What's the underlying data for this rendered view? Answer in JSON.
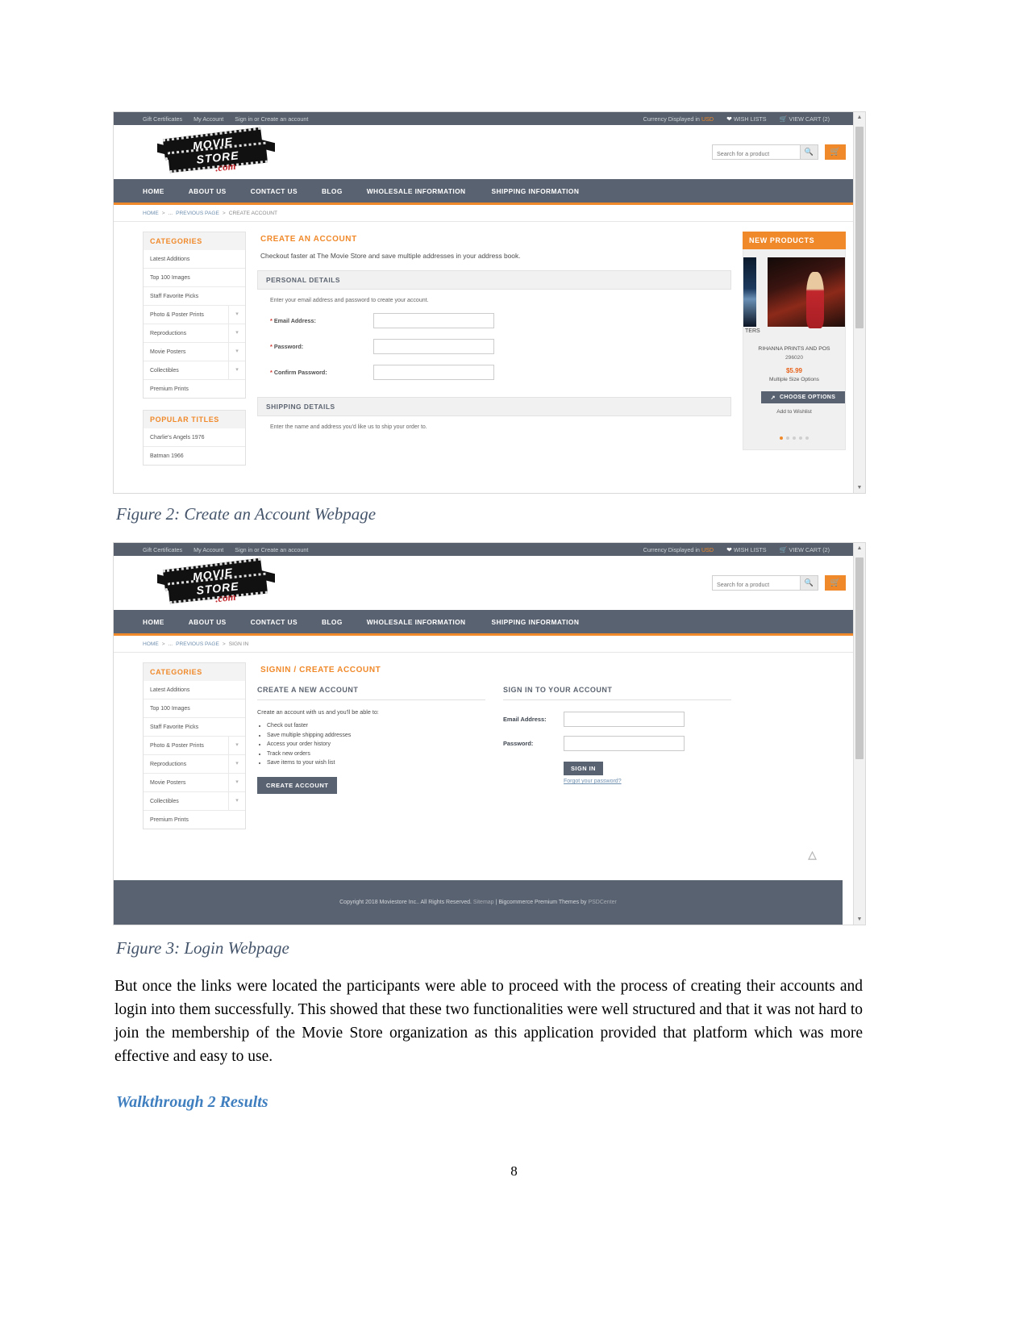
{
  "document": {
    "figure2_caption": "Figure 2: Create an Account Webpage",
    "figure3_caption": "Figure 3: Login Webpage",
    "paragraph1": "But once the links were located the participants were able to proceed with the process of creating their accounts and login into them successfully. This showed that these two functionalities were well structured and that it was not hard to join the membership of the Movie Store organization as this application provided that platform which was more effective and easy to use.",
    "heading1": "Walkthrough 2 Results",
    "page_number": "8"
  },
  "colors": {
    "accent_orange": "#f0892a",
    "nav_slate": "#596271",
    "link_blue": "#6f8faf",
    "heading_blue": "#3f7fbf",
    "price_red": "#e8621a",
    "required_red": "#d0342c"
  },
  "store": {
    "topbar": {
      "links": [
        "Gift Certificates",
        "My Account",
        "Sign in or Create an account"
      ],
      "currency_label": "Currency Displayed in",
      "currency_value": "USD",
      "wish_lists": "WISH LISTS",
      "view_cart": "VIEW CART (2)"
    },
    "logo": {
      "line1": "MOVIE",
      "line2": "STORE",
      "tld": ".com"
    },
    "search": {
      "placeholder": "Search for a product",
      "icon": "search-icon"
    },
    "nav": [
      "HOME",
      "ABOUT US",
      "CONTACT US",
      "BLOG",
      "WHOLESALE INFORMATION",
      "SHIPPING INFORMATION"
    ],
    "categories": {
      "title": "CATEGORIES",
      "items": [
        {
          "label": "Latest Additions",
          "expandable": false
        },
        {
          "label": "Top 100 Images",
          "expandable": false
        },
        {
          "label": "Staff Favorite Picks",
          "expandable": false
        },
        {
          "label": "Photo & Poster Prints",
          "expandable": true
        },
        {
          "label": "Reproductions",
          "expandable": true
        },
        {
          "label": "Movie Posters",
          "expandable": true
        },
        {
          "label": "Collectibles",
          "expandable": true
        },
        {
          "label": "Premium Prints",
          "expandable": false
        }
      ]
    },
    "popular_titles": {
      "title": "POPULAR TITLES",
      "items": [
        "Charlie's Angels 1976",
        "Batman 1966"
      ]
    },
    "new_products": {
      "title": "NEW PRODUCTS",
      "partial_label": "TERS",
      "product_name": "RIHANNA PRINTS AND POS",
      "sku": "296020",
      "price": "$5.99",
      "options_note": "Multiple Size Options",
      "choose_options": "CHOOSE OPTIONS",
      "add_to_wishlist": "Add to Wishlist",
      "dot_count": 5,
      "active_dot": 0
    }
  },
  "figure2": {
    "breadcrumb": [
      "HOME",
      "...",
      "PREVIOUS PAGE",
      "CREATE ACCOUNT"
    ],
    "title": "CREATE AN ACCOUNT",
    "subtitle": "Checkout faster at The Movie Store and save multiple addresses in your address book.",
    "personal_details": {
      "heading": "PERSONAL DETAILS",
      "hint": "Enter your email address and password to create your account.",
      "fields": [
        {
          "label": "Email Address:",
          "required": true,
          "value": ""
        },
        {
          "label": "Password:",
          "required": true,
          "value": ""
        },
        {
          "label": "Confirm Password:",
          "required": true,
          "value": ""
        }
      ]
    },
    "shipping_details": {
      "heading": "SHIPPING DETAILS",
      "hint": "Enter the name and address you'd like us to ship your order to."
    }
  },
  "figure3": {
    "breadcrumb": [
      "HOME",
      "...",
      "PREVIOUS PAGE",
      "SIGN IN"
    ],
    "title": "SIGNIN / CREATE ACCOUNT",
    "create_account": {
      "heading": "CREATE A NEW ACCOUNT",
      "intro": "Create an account with us and you'll be able to:",
      "benefits": [
        "Check out faster",
        "Save multiple shipping addresses",
        "Access your order history",
        "Track new orders",
        "Save items to your wish list"
      ],
      "button": "CREATE ACCOUNT"
    },
    "sign_in": {
      "heading": "SIGN IN TO YOUR ACCOUNT",
      "email_label": "Email Address:",
      "email_value": "",
      "password_label": "Password:",
      "password_value": "",
      "button": "SIGN IN",
      "forgot_link": "Forgot your password?"
    },
    "footer": {
      "copyright": "Copyright 2018 Moviestore Inc.. All Rights Reserved.",
      "sitemap": "Sitemap",
      "separator": "|",
      "theme_credit": "Bigcommerce Premium Themes by",
      "theme_author": "PSDCenter"
    },
    "back_to_top_icon": "chevron-up-icon"
  }
}
